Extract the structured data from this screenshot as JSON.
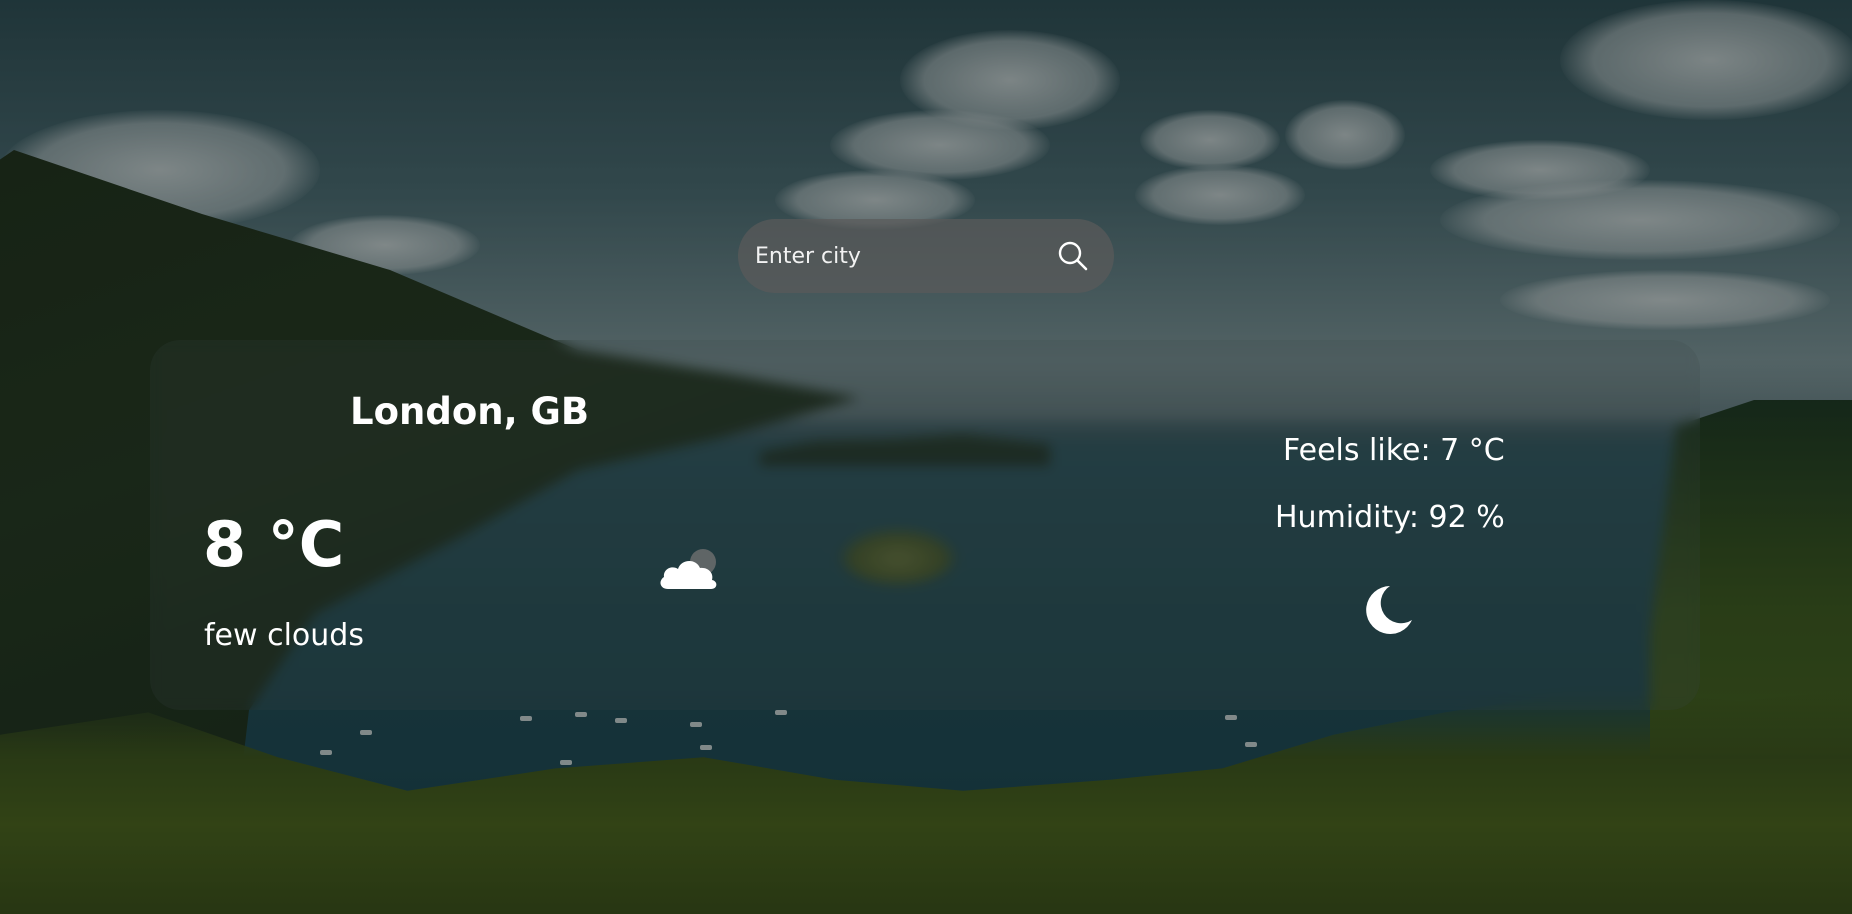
{
  "search": {
    "placeholder": "Enter city",
    "value": "",
    "icon": "search-icon"
  },
  "weather": {
    "location": "London, GB",
    "temperature": "8 °C",
    "description": "few clouds",
    "condition_icon": "cloud-icon",
    "feels_like": "Feels like: 7 °C",
    "humidity": "Humidity: 92 %",
    "time_of_day_icon": "moon-icon"
  },
  "colors": {
    "text": "#ffffff",
    "search_bg": "#5a5a5a"
  }
}
